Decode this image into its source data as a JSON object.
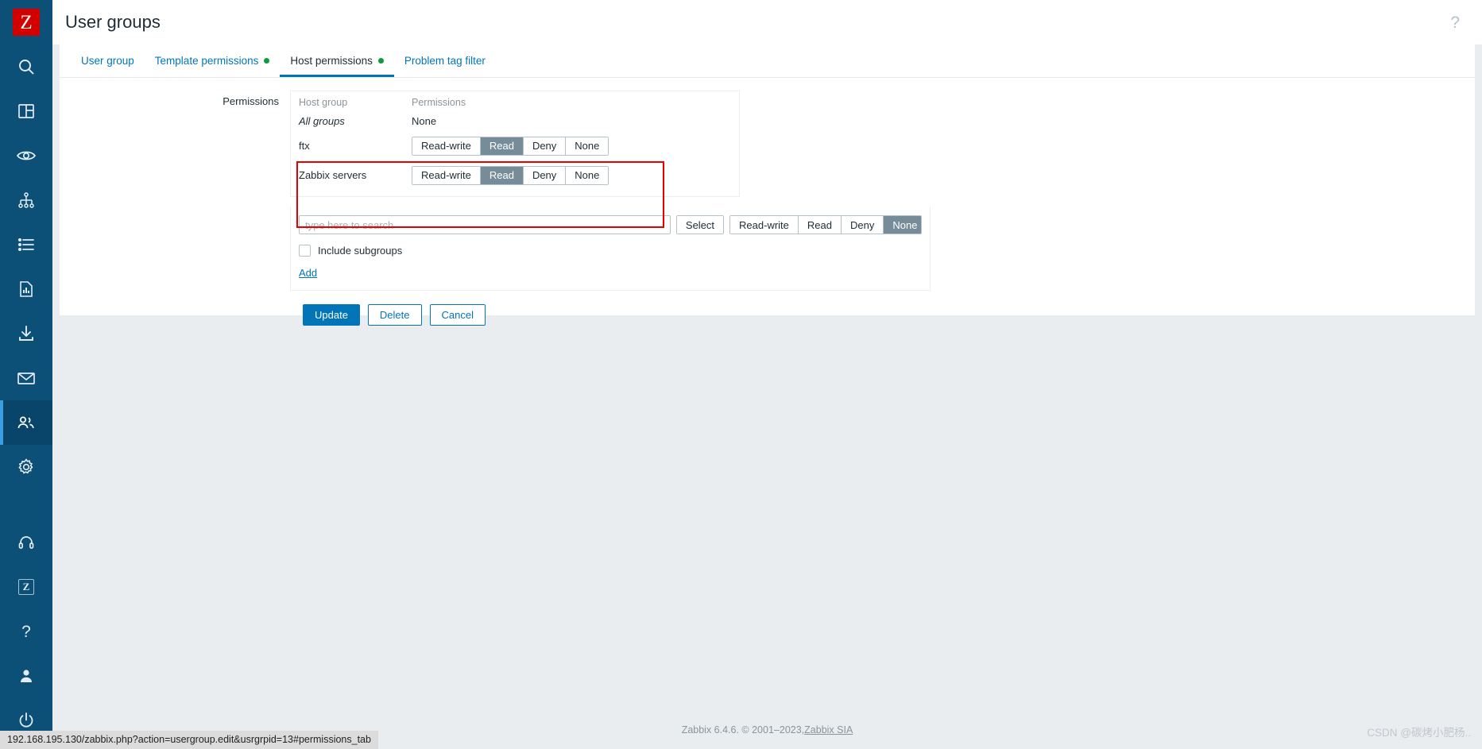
{
  "sidebar": {
    "logo_letter": "Z",
    "top_items": [
      {
        "name": "search-icon",
        "label": "Search"
      },
      {
        "name": "dashboard-icon",
        "label": "Dashboards"
      },
      {
        "name": "eye-icon",
        "label": "Monitoring"
      },
      {
        "name": "services-icon",
        "label": "Services"
      },
      {
        "name": "inventory-icon",
        "label": "Inventory"
      },
      {
        "name": "reports-icon",
        "label": "Reports"
      },
      {
        "name": "data-collection-icon",
        "label": "Data collection"
      },
      {
        "name": "alerts-icon",
        "label": "Alerts"
      },
      {
        "name": "users-icon",
        "label": "Users"
      },
      {
        "name": "gear-icon",
        "label": "Administration"
      }
    ],
    "bottom_items": [
      {
        "name": "support-icon",
        "label": "Support"
      },
      {
        "name": "integrations-icon",
        "label": "Integrations"
      },
      {
        "name": "help-icon",
        "label": "Help"
      },
      {
        "name": "user-settings-icon",
        "label": "User settings"
      },
      {
        "name": "sign-out-icon",
        "label": "Sign out"
      }
    ],
    "active_index": 8
  },
  "header": {
    "title": "User groups",
    "help_glyph": "?"
  },
  "tabs": [
    {
      "label": "User group",
      "dot": false,
      "active": false
    },
    {
      "label": "Template permissions",
      "dot": true,
      "active": false
    },
    {
      "label": "Host permissions",
      "dot": true,
      "active": true
    },
    {
      "label": "Problem tag filter",
      "dot": false,
      "active": false
    }
  ],
  "permissions": {
    "field_label": "Permissions",
    "columns": {
      "group": "Host group",
      "permission": "Permissions"
    },
    "all_groups_row": {
      "group": "All groups",
      "permission": "None"
    },
    "rows": [
      {
        "group": "ftx",
        "selected": "Read"
      },
      {
        "group": "Zabbix servers",
        "selected": "Read"
      }
    ],
    "options": [
      "Read-write",
      "Read",
      "Deny",
      "None"
    ]
  },
  "add_block": {
    "search_placeholder": "type here to search",
    "search_value": "",
    "select_label": "Select",
    "options": [
      "Read-write",
      "Read",
      "Deny",
      "None"
    ],
    "selected": "None",
    "include_subgroups_label": "Include subgroups",
    "include_subgroups_checked": false,
    "add_label": "Add"
  },
  "actions": {
    "update": "Update",
    "delete": "Delete",
    "cancel": "Cancel"
  },
  "footer": {
    "text": "Zabbix 6.4.6. © 2001–2023, ",
    "link": "Zabbix SIA"
  },
  "status_bar": {
    "url": "192.168.195.130/zabbix.php?action=usergroup.edit&usrgrpid=13#permissions_tab"
  },
  "watermark": "CSDN @碳烤小肥杨..",
  "colors": {
    "sidebar": "#0c4f77",
    "accent": "#0275b8",
    "logo_red": "#d40000",
    "selected_seg": "#768d99",
    "highlight_red": "#e60000",
    "dot_green": "#0c9b3e"
  }
}
